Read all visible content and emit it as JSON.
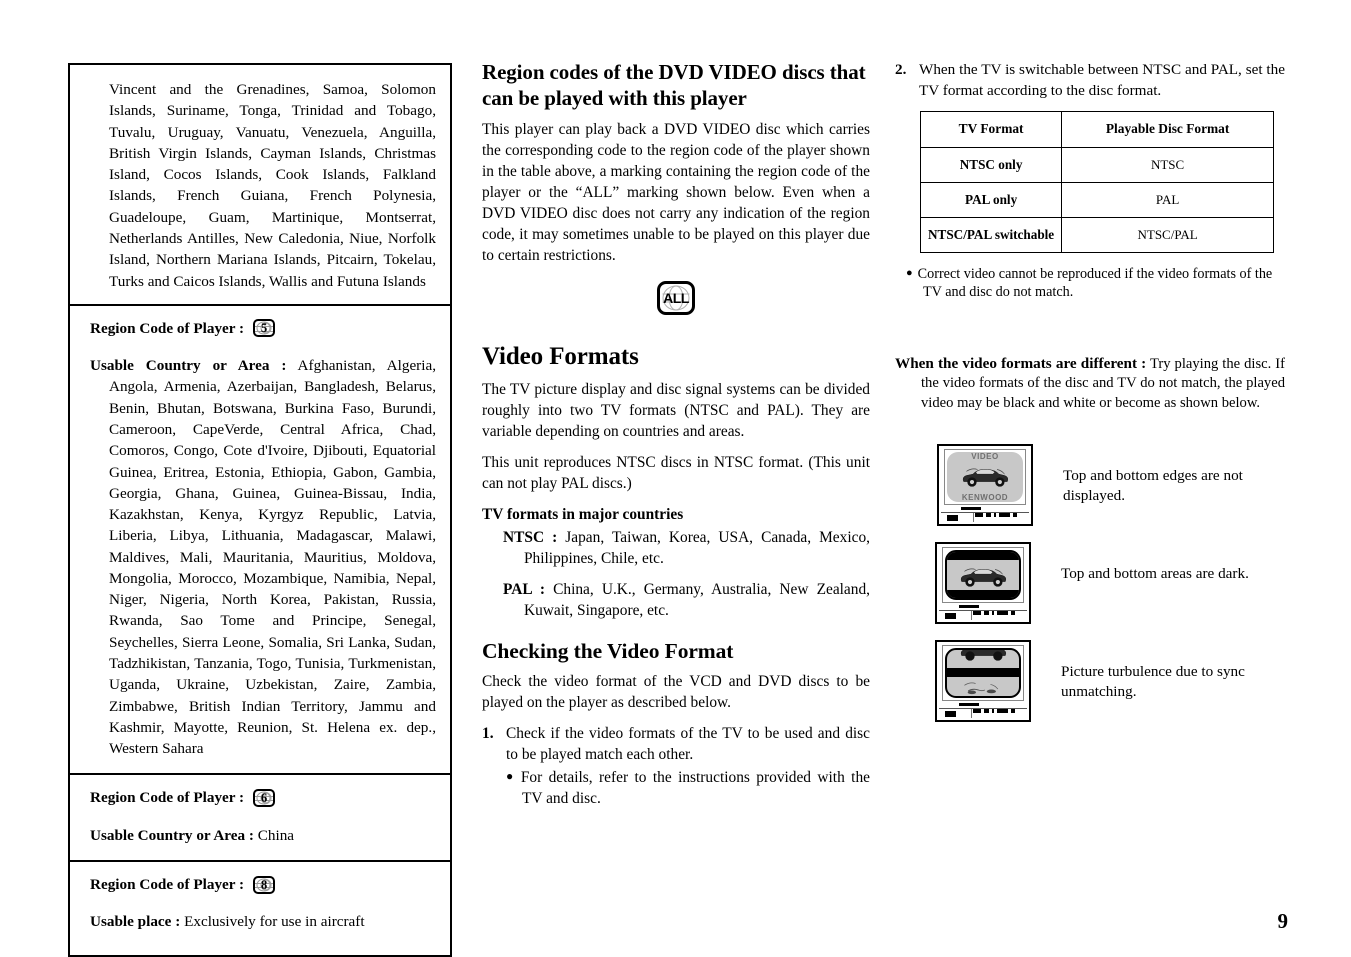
{
  "page_number": "9",
  "left_column": {
    "region_sections": [
      {
        "type": "continuation",
        "countries_text": "Vincent and the Grenadines, Samoa, Solomon Islands, Suriname, Tonga, Trinidad and Tobago, Tuvalu, Uruguay, Vanuatu, Venezuela, Anguilla, British Virgin Islands, Cayman Islands, Christmas Island, Cocos Islands, Cook Islands, Falkland Islands, French Guiana, French Polynesia, Guadeloupe, Guam, Martinique, Montserrat, Netherlands Antilles, New Caledonia, Niue, Norfolk Island, Northern Mariana Islands, Pitcairn, Tokelau, Turks and Caicos Islands, Wallis and Futuna Islands"
      },
      {
        "type": "region",
        "region_code_label": "Region Code of Player :",
        "region_code_value": "5",
        "usable_label": "Usable Country or Area :",
        "usable_value": "Afghanistan, Algeria, Angola, Armenia, Azerbaijan, Bangladesh, Belarus, Benin, Bhutan, Botswana, Burkina Faso, Burundi, Cameroon, CapeVerde, Central Africa, Chad, Comoros, Congo, Cote d'Ivoire, Djibouti, Equatorial Guinea, Eritrea, Estonia, Ethiopia, Gabon, Gambia, Georgia, Ghana, Guinea, Guinea-Bissau, India, Kazakhstan, Kenya, Kyrgyz Republic, Latvia, Liberia, Libya, Lithuania, Madagascar, Malawi, Maldives, Mali, Mauritania, Mauritius, Moldova, Mongolia, Morocco, Mozambique, Namibia, Nepal, Niger, Nigeria, North Korea, Pakistan, Russia, Rwanda, Sao Tome and Principe, Senegal, Seychelles, Sierra Leone, Somalia, Sri Lanka, Sudan, Tadzhikistan, Tanzania, Togo, Tunisia, Turkmenistan, Uganda, Ukraine, Uzbekistan, Zaire, Zambia, Zimbabwe, British Indian Territory, Jammu and Kashmir, Mayotte, Reunion, St. Helena ex. dep., Western Sahara"
      },
      {
        "type": "region",
        "region_code_label": "Region Code of Player :",
        "region_code_value": "6",
        "usable_label": "Usable Country or Area :",
        "usable_value": "China"
      },
      {
        "type": "region",
        "region_code_label": "Region Code of Player :",
        "region_code_value": "8",
        "usable_label": "Usable place :",
        "usable_value": "Exclusively for use in aircraft"
      }
    ]
  },
  "middle_column": {
    "region_codes": {
      "heading": "Region codes of the DVD VIDEO discs that can be played with this player",
      "body": "This player can play back a DVD VIDEO disc which carries the corresponding code to the region code of the player shown in the table above, a marking containing the region code of the player or the “ALL” marking shown below. Even when a DVD VIDEO disc does not carry any indication of the region code, it may sometimes unable to be played on this player due to certain restrictions.",
      "all_mark_label": "ALL"
    },
    "video_formats": {
      "heading": "Video Formats",
      "para1": "The TV picture display and disc signal systems can be divided roughly into two TV formats (NTSC and PAL). They are variable depending on countries and areas.",
      "para2": "This unit reproduces NTSC discs in NTSC format. (This unit can not play PAL discs.)",
      "subheading": "TV formats in major countries",
      "items": [
        {
          "label": "NTSC :",
          "value": "Japan, Taiwan, Korea, USA, Canada, Mexico, Philippines, Chile, etc."
        },
        {
          "label": "PAL :",
          "value": "China, U.K., Germany, Australia, New Zealand, Kuwait, Singapore, etc."
        }
      ]
    },
    "checking": {
      "heading": "Checking the Video Format",
      "intro": "Check the video format of the VCD and DVD discs to be played on the player as described below.",
      "step_number": "1.",
      "step_text": "Check if the video formats of the TV to be used and disc to be played match each other.",
      "bullet": "For details, refer to the instructions provided with the TV and disc."
    }
  },
  "right_column": {
    "step_number": "2.",
    "step_text": "When the TV is switchable between NTSC and PAL, set the TV format according to the disc format.",
    "table": {
      "headers": [
        "TV Format",
        "Playable Disc Format"
      ],
      "rows": [
        {
          "tv_format": "NTSC only",
          "disc_format": "NTSC"
        },
        {
          "tv_format": "PAL only",
          "disc_format": "PAL"
        },
        {
          "tv_format": "NTSC/PAL switchable",
          "disc_format": "NTSC/PAL"
        }
      ]
    },
    "note_bullet": "Correct video cannot be reproduced if the video formats of the TV and disc do not match.",
    "different_label": "When the video formats are different :",
    "different_text": "Try playing the disc. If the video formats of the disc and TV do not match, the played video may be black and white or become as shown below.",
    "illustrations": [
      {
        "screen_top_text": "VIDEO",
        "screen_bottom_text": "KENWOOD",
        "caption": "Top and bottom edges are not displayed."
      },
      {
        "screen_top_text": "",
        "screen_bottom_text": "",
        "caption": "Top and bottom areas are dark."
      },
      {
        "screen_top_text": "",
        "screen_bottom_text": "",
        "caption": "Picture turbulence due to sync unmatching."
      }
    ]
  }
}
